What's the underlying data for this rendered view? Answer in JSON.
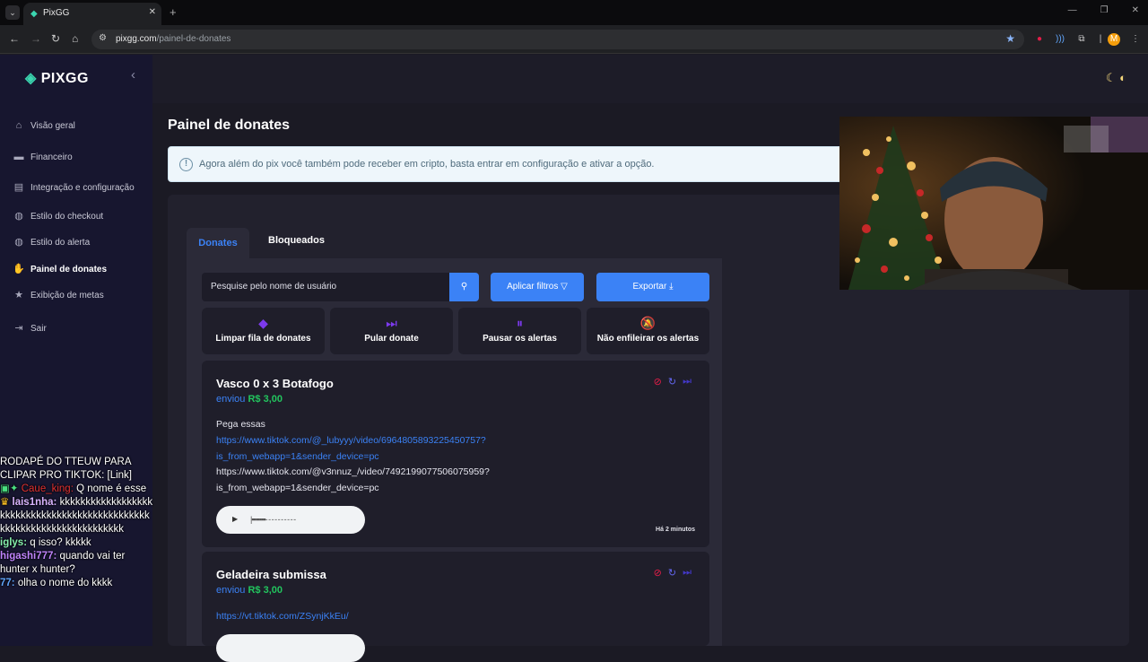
{
  "browser": {
    "tab_title": "PixGG",
    "url_domain": "pixgg.com",
    "url_path": "/painel-de-donates",
    "avatar_letter": "M"
  },
  "sidebar": {
    "logo": "PIXGG",
    "items": [
      {
        "label": "Visão geral",
        "icon": "home-icon"
      },
      {
        "label": "Financeiro",
        "icon": "wallet-icon"
      },
      {
        "label": "Integração e configuração",
        "icon": "settings-icon"
      },
      {
        "label": "Estilo do checkout",
        "icon": "palette-icon"
      },
      {
        "label": "Estilo do alerta",
        "icon": "palette-icon"
      },
      {
        "label": "Painel de donates",
        "icon": "hand-coin-icon"
      },
      {
        "label": "Exibição de metas",
        "icon": "star-icon"
      },
      {
        "label": "Sair",
        "icon": "logout-icon"
      }
    ]
  },
  "main": {
    "title": "Painel de donates",
    "info": "Agora além do pix você também pode receber em cripto, basta entrar em configuração e ativar a opção.",
    "tabs": [
      "Donates",
      "Bloqueados"
    ],
    "search_placeholder": "Pesquise pelo nome de usuário",
    "filter_label": "Aplicar filtros",
    "export_label": "Exportar",
    "actions": [
      "Limpar fila de donates",
      "Pular donate",
      "Pausar os alertas",
      "Não enfileirar os alertas"
    ],
    "donates": [
      {
        "name": "Vasco 0 x 3 Botafogo",
        "prefix": "enviou",
        "amount": "R$ 3,00",
        "message": "Pega essas",
        "link1a": "https://www.tiktok.com/@_lubyyy/video/6964805893225450757?",
        "link1b": "is_from_webapp=1&sender_device=pc",
        "text2a": "https://www.tiktok.com/@v3nnuz_/video/7492199077506075959?",
        "text2b": "is_from_webapp=1&sender_device=pc",
        "time": "Há 2 minutos"
      },
      {
        "name": "Geladeira submissa",
        "prefix": "enviou",
        "amount": "R$ 3,00",
        "link1a": "https://vt.tiktok.com/ZSynjKkEu/"
      }
    ]
  },
  "chat": {
    "lines": [
      {
        "user": "",
        "text": "RODAPÉ DO TTEUW PARA CLIPAR PRO TIKTOK: [Link]"
      },
      {
        "user": "Caue_king:",
        "text": "Q nome é esse"
      },
      {
        "user": "lais1nha:",
        "text": "kkkkkkkkkkkkkkkkkkkkkkkkkkkkkkkkkkkkkkkkkkkkkkkkkkkkkkkkkkkkkkkkkkkkkkk"
      },
      {
        "user": "iglys:",
        "text": "q isso? kkkkk"
      },
      {
        "user": "higashi777:",
        "text": "quando vai ter hunter x hunter?"
      },
      {
        "user": "77:",
        "text": "olha o nome do kkkk"
      }
    ]
  }
}
